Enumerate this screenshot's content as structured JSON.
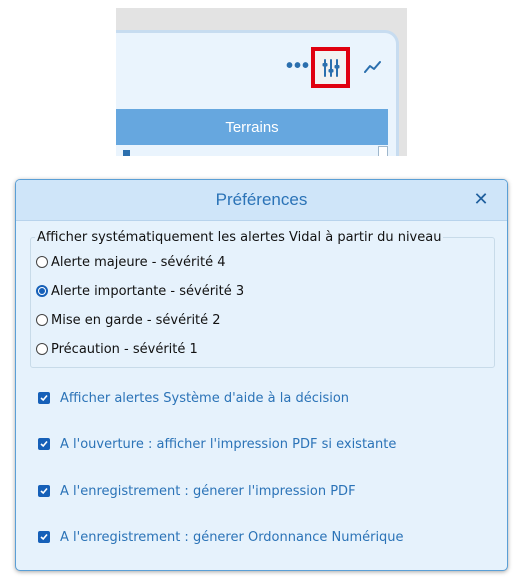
{
  "toolbar": {
    "more_glyph": "•••",
    "tab_label": "Terrains",
    "icons": [
      "more-icon",
      "sliders-icon",
      "trend-icon"
    ]
  },
  "dialog": {
    "title": "Préférences",
    "close_glyph": "✕",
    "level_group": {
      "label": "Afficher systématiquement les alertes Vidal à partir du niveau",
      "options": [
        {
          "label": "Alerte majeure - sévérité 4",
          "checked": false
        },
        {
          "label": "Alerte importante - sévérité 3",
          "checked": true
        },
        {
          "label": "Mise en garde - sévérité 2",
          "checked": false
        },
        {
          "label": "Précaution - sévérité 1",
          "checked": false
        }
      ]
    },
    "checkboxes": [
      {
        "label": "Afficher alertes Système d'aide à la décision",
        "checked": true
      },
      {
        "label": "A l'ouverture : afficher l'impression PDF si existante",
        "checked": true
      },
      {
        "label": "A l'enregistrement : génerer l'impression PDF",
        "checked": true
      },
      {
        "label": "A l'enregistrement : génerer Ordonnance Numérique",
        "checked": true
      }
    ]
  },
  "colors": {
    "accent": "#2b73b7",
    "highlight": "#e0000f",
    "tab_bg": "#66a7df"
  }
}
